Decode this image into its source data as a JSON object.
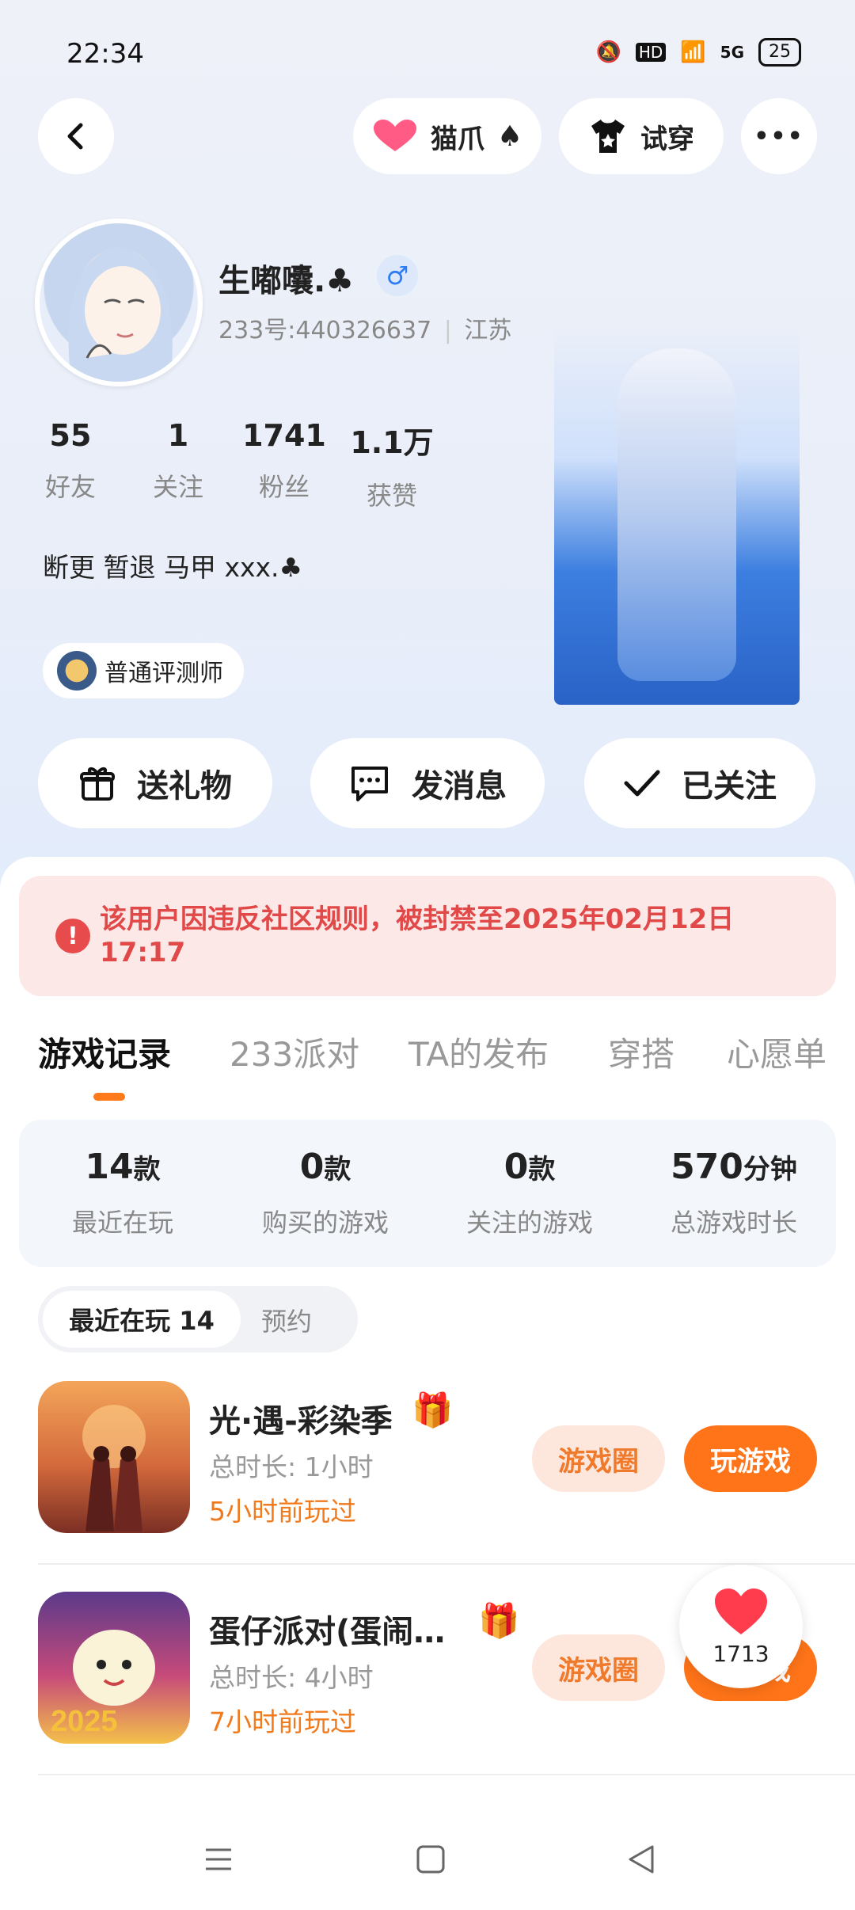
{
  "status_bar": {
    "time": "22:34",
    "hd": "HD",
    "net": "5G",
    "battery": "25"
  },
  "header": {
    "back_label": "‹",
    "pet_label": "猫爪",
    "pet_suit": "♠",
    "tryon_label": "试穿",
    "more_label": "•••"
  },
  "profile": {
    "name": "生嘟囔.♣",
    "gender": "♂",
    "uid": "233号:440326637",
    "location": "江苏",
    "stats": [
      {
        "value": "55",
        "label": "好友"
      },
      {
        "value": "1",
        "label": "关注"
      },
      {
        "value": "1741",
        "label": "粉丝"
      },
      {
        "value": "1.1万",
        "label": "获赞"
      }
    ],
    "bio": "断更 暂退 马甲 xxx.♣",
    "badge": "普通评测师"
  },
  "actions": {
    "gift": "送礼物",
    "message": "发消息",
    "follow": "已关注"
  },
  "ban_notice": "该用户因违反社区规则，被封禁至2025年02月12日 17:17",
  "tabs": [
    "游戏记录",
    "233派对",
    "TA的发布",
    "穿搭",
    "心愿单"
  ],
  "summary": [
    {
      "num": "14",
      "unit": "款",
      "label": "最近在玩"
    },
    {
      "num": "0",
      "unit": "款",
      "label": "购买的游戏"
    },
    {
      "num": "0",
      "unit": "款",
      "label": "关注的游戏"
    },
    {
      "num": "570",
      "unit": "分钟",
      "label": "总游戏时长"
    }
  ],
  "segments": {
    "recent": "最近在玩 14",
    "reserve": "预约"
  },
  "games": [
    {
      "title": "光·遇-彩染季",
      "time": "总时长:  1小时",
      "last": "5小时前玩过",
      "circle": "游戏圈",
      "play": "玩游戏"
    },
    {
      "title": "蛋仔派对(蛋闹…",
      "time": "总时长:  4小时",
      "last": "7小时前玩过",
      "circle": "游戏圈",
      "play": "玩游戏"
    }
  ],
  "like_float": {
    "count": "1713"
  },
  "colors": {
    "accent": "#ff7418",
    "ban_red": "#e14848",
    "tab_indicator": "#ff7a1a"
  }
}
